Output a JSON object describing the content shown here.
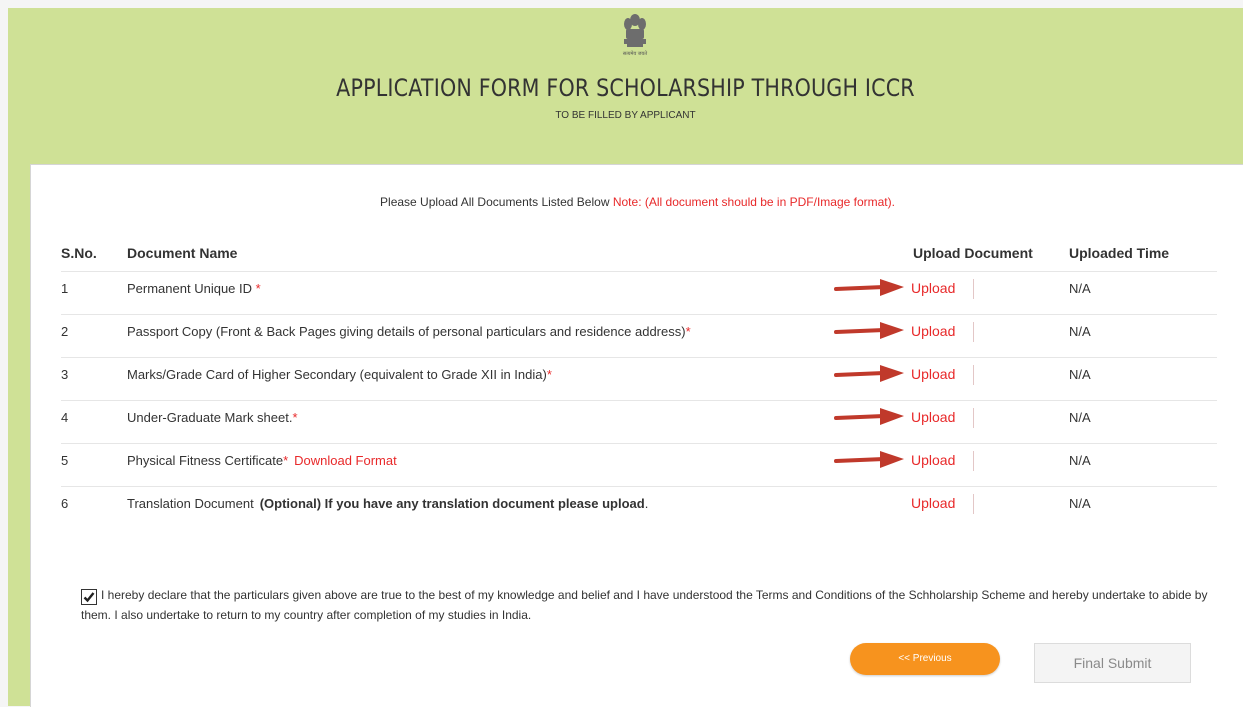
{
  "header": {
    "title": "APPLICATION FORM FOR SCHOLARSHIP THROUGH ICCR",
    "subtitle": "TO BE FILLED BY APPLICANT",
    "emblem_text": "सत्यमेव जयते"
  },
  "notice": {
    "text": "Please Upload All Documents Listed Below",
    "note": "Note: (All document should be in PDF/Image format)."
  },
  "table": {
    "headers": {
      "sno": "S.No.",
      "name": "Document Name",
      "upload": "Upload Document",
      "time": "Uploaded Time"
    },
    "rows": [
      {
        "sno": "1",
        "name": "Permanent Unique ID",
        "required": " *",
        "link": "",
        "extra": "",
        "upload": "Upload",
        "time": "N/A"
      },
      {
        "sno": "2",
        "name": "Passport Copy (Front & Back Pages giving details of personal particulars and residence address)",
        "required": "*",
        "link": "",
        "extra": "",
        "upload": "Upload",
        "time": "N/A"
      },
      {
        "sno": "3",
        "name": "Marks/Grade Card of Higher Secondary (equivalent to Grade XII in India)",
        "required": "*",
        "link": "",
        "extra": "",
        "upload": "Upload",
        "time": "N/A"
      },
      {
        "sno": "4",
        "name": "Under-Graduate Mark sheet.",
        "required": "*",
        "link": "",
        "extra": "",
        "upload": "Upload",
        "time": "N/A"
      },
      {
        "sno": "5",
        "name": "Physical Fitness Certificate",
        "required": "*",
        "link": "Download Format",
        "extra": "",
        "upload": "Upload",
        "time": "N/A"
      },
      {
        "sno": "6",
        "name": "Translation Document",
        "required": "",
        "link": "",
        "extra": "(Optional) If you have any translation document please upload",
        "upload": "Upload",
        "time": "N/A"
      }
    ]
  },
  "declaration": {
    "checked": true,
    "text": "I hereby declare that the particulars given above are true to the best of my knowledge and belief and I have understood the Terms and Conditions of the Schholarship Scheme and hereby undertake to abide by them. I also undertake to return to my country after completion of my studies in India."
  },
  "buttons": {
    "previous": "<< Previous",
    "submit": "Final Submit"
  },
  "colors": {
    "header_bg": "#cfe196",
    "required_red": "#e8292a",
    "previous_orange": "#f7931e",
    "arrow_red": "#c0392b"
  },
  "icons": {
    "emblem": "national-emblem-icon",
    "arrow": "arrow-right-icon",
    "check": "checkmark-icon"
  }
}
